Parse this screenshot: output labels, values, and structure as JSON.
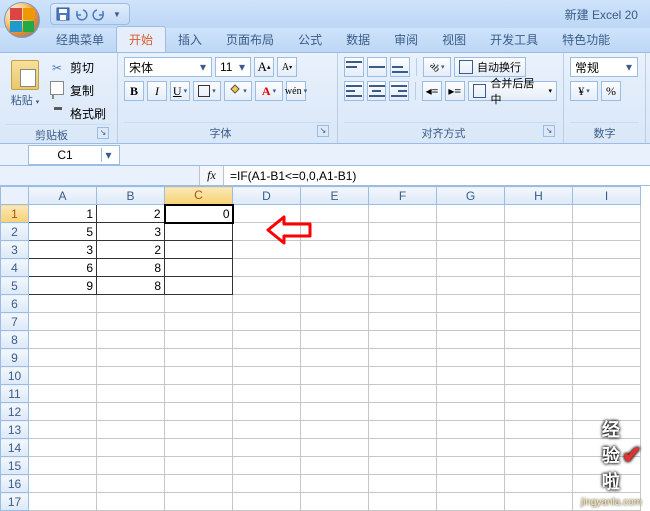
{
  "title": "新建 Excel 20",
  "tabs": [
    "经典菜单",
    "开始",
    "插入",
    "页面布局",
    "公式",
    "数据",
    "审阅",
    "视图",
    "开发工具",
    "特色功能"
  ],
  "activeTab": 1,
  "clipboard": {
    "paste": "粘贴",
    "cut": "剪切",
    "copy": "复制",
    "format_painter": "格式刷",
    "group": "剪贴板"
  },
  "font": {
    "name": "宋体",
    "size": "11",
    "group": "字体"
  },
  "alignment": {
    "wrap": "自动换行",
    "merge": "合并后居中",
    "group": "对齐方式"
  },
  "number": {
    "format": "常规",
    "group": "数字"
  },
  "namebox": "C1",
  "formula": "=IF(A1-B1<=0,0,A1-B1)",
  "fx": "fx",
  "columns": [
    "A",
    "B",
    "C",
    "D",
    "E",
    "F",
    "G",
    "H",
    "I"
  ],
  "rows": 17,
  "selected": {
    "row": 1,
    "col": 3
  },
  "cells": {
    "A1": "1",
    "B1": "2",
    "C1": "0",
    "A2": "5",
    "B2": "3",
    "A3": "3",
    "B3": "2",
    "A4": "6",
    "B4": "8",
    "A5": "9",
    "B5": "8"
  },
  "borderedRange": {
    "r1": 1,
    "r2": 5,
    "c1": 1,
    "c2": 3
  },
  "watermark": {
    "text": "经验啦",
    "sub": "jingyanla.com"
  }
}
